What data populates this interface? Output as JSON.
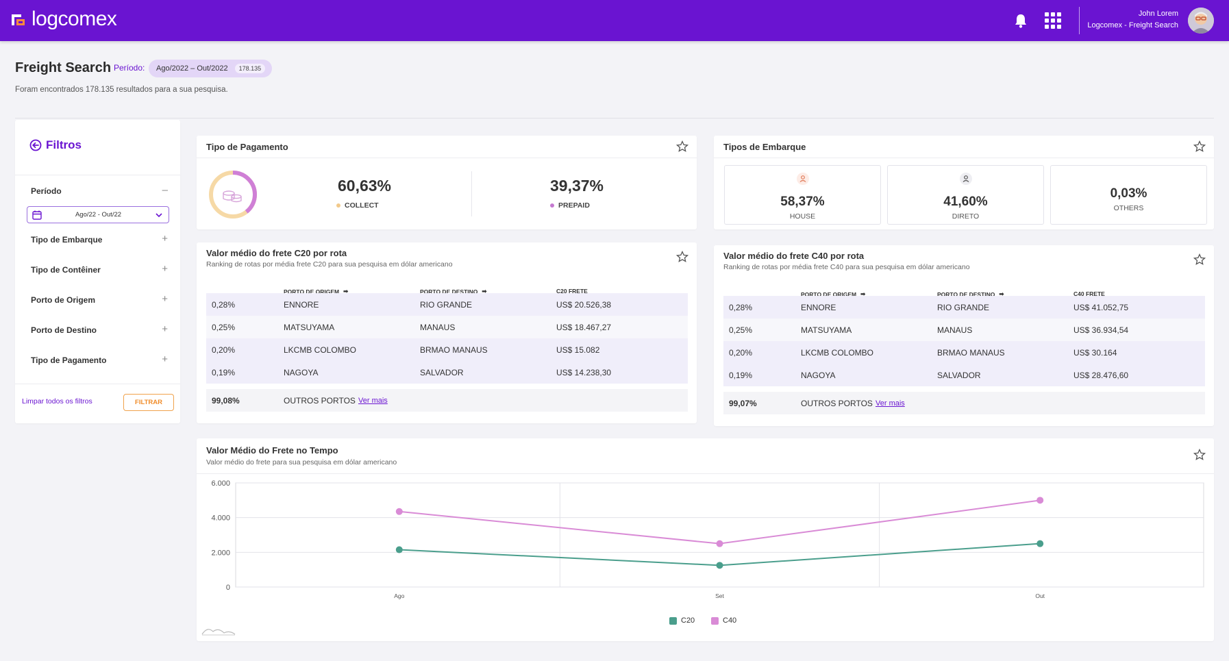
{
  "app": {
    "brand": "logcomex",
    "user_name": "John Lorem",
    "user_context": "Logcomex - Freight Search"
  },
  "colors": {
    "brand": "#6a14d1",
    "c20": "#4a9e8c",
    "c40": "#d98bd6",
    "collect": "#f2c98a",
    "prepaid": "#c57ad0"
  },
  "header": {
    "title": "Freight Search",
    "periodo_label": "Período:",
    "periodo_value": "Ago/2022 – Out/2022",
    "count_badge": "178.135",
    "subtitle": "Foram encontrados 178.135 resultados para a sua pesquisa."
  },
  "filters": {
    "title": "Filtros",
    "periodo_label": "Período",
    "periodo_select": "Ago/22 - Out/22",
    "items": [
      "Tipo de Embarque",
      "Tipo de Contêiner",
      "Porto de Origem",
      "Porto de Destino",
      "Tipo de Pagamento"
    ],
    "collapse_symbol": "–",
    "expand_symbol": "+",
    "clear_label": "Limpar todos os filtros",
    "filter_button": "FILTRAR"
  },
  "payment": {
    "title": "Tipo de Pagamento",
    "collect_value": "60,63%",
    "collect_label": "COLLECT",
    "prepaid_value": "39,37%",
    "prepaid_label": "PREPAID",
    "collect_fraction": 0.6063
  },
  "shipment": {
    "title": "Tipos de Embarque",
    "items": [
      {
        "value": "58,37%",
        "label": "HOUSE",
        "icon": "person-icon"
      },
      {
        "value": "41,60%",
        "label": "DIRETO",
        "icon": "person-icon"
      },
      {
        "value": "0,03%",
        "label": "OTHERS",
        "icon": ""
      }
    ]
  },
  "c20": {
    "title": "Valor médio do frete C20 por rota",
    "subtitle": "Ranking de rotas por média frete C20 para sua pesquisa em dólar americano",
    "columns": [
      "PORTO DE ORIGEM",
      "PORTO DE DESTINO",
      "C20 FRETE"
    ],
    "rows": [
      [
        "0,28%",
        "ENNORE",
        "RIO GRANDE",
        "US$ 20.526,38"
      ],
      [
        "0,25%",
        "MATSUYAMA",
        "MANAUS",
        "US$ 18.467,27"
      ],
      [
        "0,20%",
        "LKCMB COLOMBO",
        "BRMAO MANAUS",
        "US$ 15.082"
      ],
      [
        "0,19%",
        "NAGOYA",
        "SALVADOR",
        "US$ 14.238,30"
      ]
    ],
    "total_pct": "99,08%",
    "total_label": "OUTROS PORTOS",
    "more_link": "Ver mais"
  },
  "c40": {
    "title": "Valor médio do frete C40 por rota",
    "subtitle": "Ranking de rotas por média frete C40 para sua pesquisa em dólar americano",
    "columns": [
      "PORTO DE ORIGEM",
      "PORTO DE DESTINO",
      "C40 FRETE"
    ],
    "rows": [
      [
        "0,28%",
        "ENNORE",
        "RIO GRANDE",
        "US$ 41.052,75"
      ],
      [
        "0,25%",
        "MATSUYAMA",
        "MANAUS",
        "US$ 36.934,54"
      ],
      [
        "0,20%",
        "LKCMB COLOMBO",
        "BRMAO MANAUS",
        "US$ 30.164"
      ],
      [
        "0,19%",
        "NAGOYA",
        "SALVADOR",
        "US$ 28.476,60"
      ]
    ],
    "total_pct": "99,07%",
    "total_label": "OUTROS PORTOS",
    "more_link": "Ver mais"
  },
  "chart_data": {
    "type": "line",
    "title": "Valor Médio do Frete no Tempo",
    "subtitle": "Valor médio do frete para sua pesquisa em dólar americano",
    "categories": [
      "Ago",
      "Set",
      "Out"
    ],
    "series": [
      {
        "name": "C20",
        "values": [
          2150,
          1250,
          2500
        ],
        "color": "#4a9e8c"
      },
      {
        "name": "C40",
        "values": [
          4350,
          2500,
          5000
        ],
        "color": "#d98bd6"
      }
    ],
    "y_ticks": [
      "6.000",
      "4.000",
      "2.000",
      "0"
    ],
    "ylim": [
      0,
      6000
    ],
    "grid": true,
    "legend": "bottom"
  }
}
